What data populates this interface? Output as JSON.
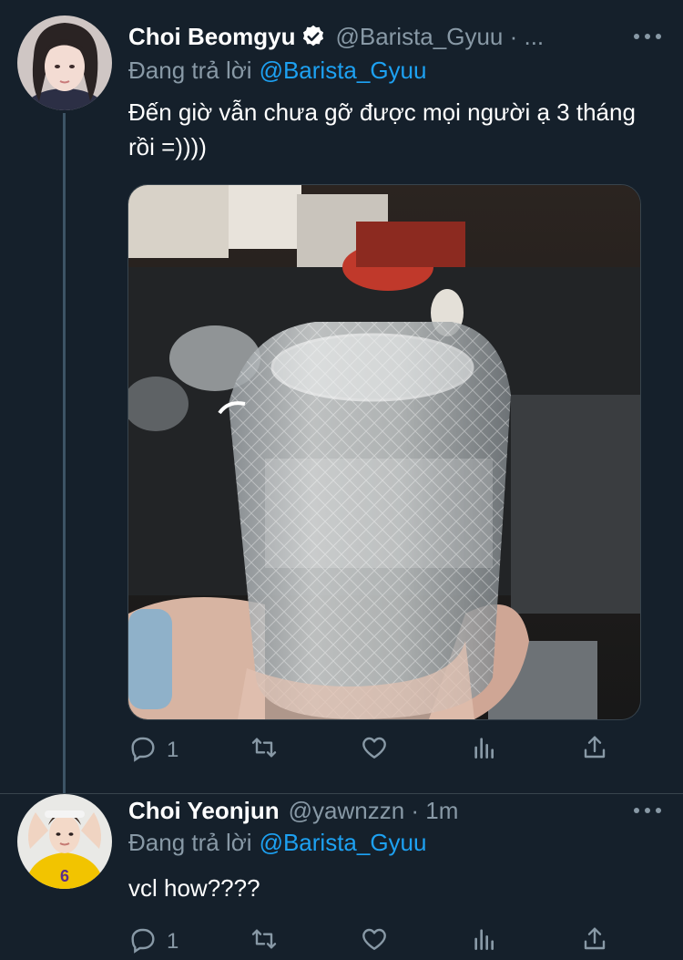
{
  "tweets": [
    {
      "name": "Choi Beomgyu",
      "verified": true,
      "handle": "@Barista_Gyuu · ...",
      "reply_prefix": "Đang trả lời",
      "reply_to": "@Barista_Gyuu",
      "text": "Đến giờ vẫn chưa gỡ được mọi người ạ 3 tháng rồi =))))",
      "has_media": true,
      "actions": {
        "reply_count": "1",
        "retweet_count": "",
        "like_count": ""
      }
    },
    {
      "name": "Choi Yeonjun",
      "verified": false,
      "handle": "@yawnzzn · 1m",
      "reply_prefix": "Đang trả lời",
      "reply_to": "@Barista_Gyuu",
      "text": "vcl how????",
      "has_media": false,
      "actions": {
        "reply_count": "1",
        "retweet_count": "",
        "like_count": ""
      }
    }
  ],
  "colors": {
    "background": "#15202b",
    "secondary_text": "#8899a6",
    "accent": "#1da1f2",
    "divider": "#38444d"
  },
  "icons": [
    "reply-icon",
    "retweet-icon",
    "like-icon",
    "analytics-icon",
    "share-icon",
    "more-icon",
    "verified-badge-icon"
  ]
}
